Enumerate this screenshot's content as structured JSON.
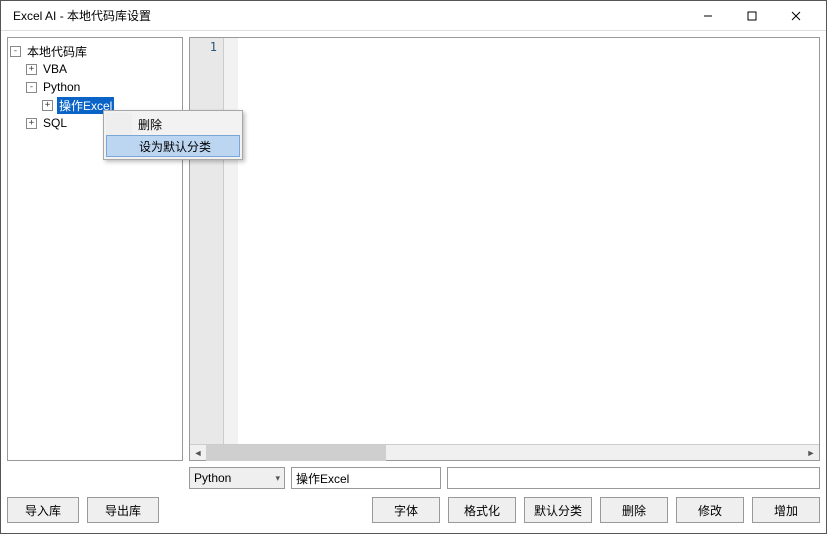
{
  "window": {
    "title": "Excel AI - 本地代码库设置"
  },
  "tree": {
    "root": "本地代码库",
    "vba": "VBA",
    "python": "Python",
    "python_child": "操作Excel",
    "sql": "SQL"
  },
  "context_menu": {
    "delete": "删除",
    "set_default": "设为默认分类"
  },
  "editor": {
    "line1": "1"
  },
  "inputs": {
    "lang_select": "Python",
    "name_value": "操作Excel",
    "desc_value": ""
  },
  "buttons": {
    "import": "导入库",
    "export": "导出库",
    "font": "字体",
    "format": "格式化",
    "default_cat": "默认分类",
    "delete": "删除",
    "modify": "修改",
    "add": "增加"
  }
}
